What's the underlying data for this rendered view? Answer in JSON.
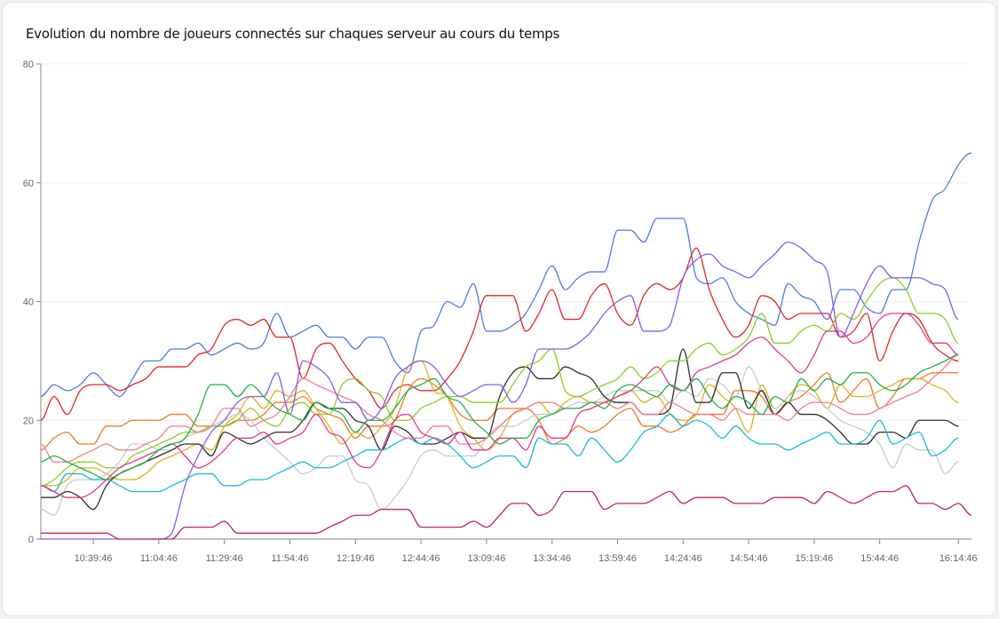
{
  "card": {
    "title": "Evolution du nombre de joueurs connectés sur chaques serveur au cours du temps"
  },
  "chart_data": {
    "type": "line",
    "title": "Evolution du nombre de joueurs connectés sur chaques serveur au cours du temps",
    "xlabel": "",
    "ylabel": "",
    "ylim": [
      0,
      80
    ],
    "yticks": [
      0,
      20,
      40,
      60,
      80
    ],
    "grid": true,
    "legend_position": "bottom",
    "x_start": "10:19:46",
    "x_step_minutes": 5,
    "xtick_labels": [
      "10:39:46",
      "11:04:46",
      "11:29:46",
      "11:54:46",
      "12:19:46",
      "12:44:46",
      "13:09:46",
      "13:34:46",
      "13:59:46",
      "14:24:46",
      "14:54:46",
      "15:19:46",
      "15:44:46",
      "16:14:46"
    ],
    "xtick_index": [
      4,
      9,
      14,
      19,
      24,
      29,
      34,
      39,
      44,
      49,
      54,
      59,
      64,
      70
    ],
    "series": [
      {
        "name": "blue",
        "color": "#4e7fe0",
        "values": [
          24,
          26,
          25,
          26,
          28,
          26,
          24,
          27,
          30,
          30,
          32,
          32,
          33,
          31,
          32,
          33,
          32,
          33,
          38,
          34,
          35,
          36,
          34,
          34,
          32,
          34,
          34,
          30,
          28,
          35,
          36,
          40,
          39,
          43,
          35,
          35,
          36,
          38,
          42,
          46,
          42,
          44,
          45,
          45,
          52,
          52,
          50,
          54,
          54,
          54,
          44,
          43,
          44,
          40,
          38,
          37,
          36,
          43,
          41,
          40,
          37,
          42,
          42,
          39,
          38,
          42,
          42,
          50,
          57,
          59,
          63,
          65
        ]
      },
      {
        "name": "red",
        "color": "#e02828",
        "values": [
          20,
          24,
          21,
          25,
          26,
          26,
          25,
          26,
          27,
          29,
          29,
          29,
          31,
          32,
          36,
          37,
          36,
          37,
          34,
          34,
          27,
          32,
          33,
          30,
          27,
          25,
          22,
          25,
          26,
          25,
          25,
          27,
          30,
          35,
          41,
          41,
          41,
          35,
          38,
          42,
          37,
          37,
          41,
          43,
          38,
          36,
          41,
          43,
          42,
          44,
          49,
          42,
          37,
          34,
          36,
          41,
          40,
          37,
          38,
          38,
          38,
          34,
          35,
          38,
          30,
          35,
          38,
          37,
          33,
          31,
          30
        ]
      },
      {
        "name": "orange",
        "color": "#f07a2a",
        "values": [
          15,
          17,
          18,
          16,
          16,
          19,
          19,
          20,
          20,
          20,
          21,
          21,
          19,
          19,
          19,
          20,
          20,
          21,
          23,
          23,
          24,
          22,
          21,
          20,
          17,
          19,
          19,
          20,
          25,
          27,
          26,
          24,
          21,
          20,
          20,
          22,
          22,
          22,
          20,
          16,
          17,
          19,
          18,
          19,
          21,
          22,
          19,
          19,
          18,
          19,
          21,
          21,
          21,
          25,
          25,
          24,
          21,
          23,
          24,
          26,
          28,
          23,
          25,
          27,
          22,
          24,
          27,
          27,
          28,
          28,
          28
        ]
      },
      {
        "name": "yellow",
        "color": "#dbb51f",
        "values": [
          9,
          9,
          10,
          12,
          12,
          11,
          10,
          10,
          11,
          13,
          14,
          15,
          16,
          15,
          19,
          21,
          24,
          22,
          25,
          24,
          25,
          22,
          19,
          16,
          18,
          17,
          19,
          22,
          29,
          30,
          25,
          24,
          19,
          17,
          15,
          17,
          21,
          22,
          23,
          21,
          23,
          24,
          23,
          23,
          24,
          25,
          23,
          24,
          21,
          20,
          21,
          26,
          24,
          22,
          18,
          26,
          22,
          24,
          26,
          25,
          22,
          26,
          24,
          24,
          25,
          26,
          27,
          27,
          26,
          25,
          23
        ]
      },
      {
        "name": "white",
        "color": "#c8cbd0",
        "values": [
          5,
          4,
          9,
          10,
          10,
          11,
          13,
          16,
          16,
          15,
          15,
          17,
          18,
          19,
          20,
          21,
          20,
          17,
          15,
          13,
          11,
          12,
          14,
          14,
          10,
          9,
          5,
          7,
          10,
          14,
          15,
          14,
          14,
          14,
          17,
          19,
          19,
          20,
          21,
          21,
          22,
          23,
          23,
          24,
          25,
          25,
          25,
          25,
          23,
          25,
          24,
          27,
          26,
          24,
          29,
          25,
          22,
          24,
          25,
          24,
          22,
          20,
          19,
          18,
          16,
          12,
          16,
          15,
          15,
          11,
          13
        ]
      },
      {
        "name": "black",
        "color": "#303030",
        "values": [
          7,
          7,
          8,
          7,
          5,
          9,
          11,
          12,
          13,
          14,
          15,
          16,
          16,
          14,
          18,
          17,
          16,
          17,
          18,
          18,
          20,
          23,
          22,
          22,
          20,
          19,
          15,
          19,
          18,
          16,
          16,
          17,
          18,
          17,
          17,
          24,
          28,
          29,
          27,
          27,
          29,
          28,
          27,
          24,
          23,
          23,
          21,
          21,
          22,
          32,
          23,
          23,
          28,
          28,
          22,
          25,
          21,
          23,
          21,
          21,
          20,
          18,
          16,
          16,
          18,
          18,
          17,
          20,
          20,
          20,
          19
        ]
      },
      {
        "name": "cyan",
        "color": "#1cbcd6",
        "values": [
          9,
          8,
          11,
          11,
          10,
          10,
          9,
          8,
          8,
          8,
          9,
          10,
          11,
          11,
          9,
          9,
          10,
          10,
          11,
          12,
          13,
          12,
          12,
          13,
          14,
          15,
          15,
          16,
          17,
          16,
          17,
          16,
          14,
          12,
          13,
          14,
          14,
          12,
          17,
          16,
          16,
          14,
          17,
          15,
          13,
          15,
          18,
          19,
          21,
          19,
          20,
          19,
          17,
          19,
          17,
          16,
          16,
          15,
          16,
          17,
          18,
          16,
          16,
          17,
          20,
          16,
          17,
          18,
          14,
          15,
          17
        ]
      },
      {
        "name": "lime",
        "color": "#8ccf23",
        "values": [
          9,
          10,
          12,
          13,
          13,
          12,
          12,
          14,
          15,
          16,
          17,
          18,
          18,
          19,
          19,
          20,
          22,
          20,
          19,
          22,
          23,
          21,
          21,
          26,
          27,
          25,
          24,
          20,
          20,
          22,
          23,
          24,
          24,
          23,
          23,
          23,
          26,
          29,
          30,
          32,
          25,
          24,
          25,
          26,
          27,
          29,
          27,
          28,
          30,
          30,
          32,
          33,
          31,
          32,
          34,
          38,
          33,
          33,
          35,
          36,
          35,
          38,
          37,
          40,
          43,
          44,
          42,
          38,
          38,
          37,
          33
        ]
      },
      {
        "name": "coral",
        "color": "#f07f92",
        "values": [
          16,
          13,
          13,
          14,
          15,
          16,
          15,
          15,
          16,
          17,
          19,
          19,
          18,
          19,
          22,
          22,
          19,
          20,
          21,
          24,
          27,
          26,
          25,
          24,
          23,
          21,
          20,
          18,
          17,
          17,
          19,
          19,
          16,
          16,
          17,
          19,
          21,
          22,
          23,
          23,
          22,
          22,
          23,
          23,
          22,
          23,
          21,
          21,
          23,
          22,
          21,
          21,
          20,
          22,
          21,
          21,
          21,
          20,
          22,
          23,
          23,
          22,
          21,
          21,
          22,
          23,
          24,
          25,
          27,
          29,
          31
        ]
      },
      {
        "name": "pink",
        "color": "#e43a8c",
        "values": [
          9,
          8,
          7,
          7,
          8,
          10,
          12,
          13,
          14,
          15,
          16,
          14,
          12,
          13,
          15,
          17,
          17,
          18,
          16,
          17,
          18,
          21,
          18,
          17,
          13,
          12,
          15,
          20,
          21,
          18,
          17,
          16,
          18,
          15,
          15,
          17,
          17,
          15,
          19,
          17,
          17,
          21,
          22,
          23,
          24,
          25,
          27,
          29,
          26,
          25,
          28,
          29,
          30,
          31,
          33,
          34,
          32,
          30,
          28,
          31,
          35,
          35,
          33,
          34,
          37,
          38,
          38,
          36,
          33,
          33,
          31
        ]
      },
      {
        "name": "purple",
        "color": "#8a5ce6",
        "values": [
          0,
          0,
          0,
          0,
          0,
          0,
          0,
          0,
          0,
          0,
          1,
          9,
          14,
          18,
          20,
          23,
          24,
          24,
          28,
          21,
          30,
          29,
          27,
          23,
          23,
          20,
          22,
          27,
          29,
          30,
          29,
          26,
          24,
          25,
          26,
          26,
          23,
          26,
          32,
          32,
          32,
          33,
          35,
          38,
          40,
          41,
          35,
          35,
          36,
          44,
          47,
          48,
          46,
          45,
          44,
          46,
          48,
          50,
          49,
          47,
          45,
          34,
          38,
          43,
          46,
          44,
          44,
          44,
          43,
          42,
          37
        ]
      },
      {
        "name": "green",
        "color": "#22b14c",
        "values": [
          13,
          14,
          13,
          12,
          11,
          10,
          11,
          12,
          13,
          15,
          16,
          17,
          21,
          26,
          26,
          24,
          26,
          24,
          22,
          21,
          20,
          23,
          22,
          21,
          18,
          20,
          20,
          22,
          25,
          26,
          27,
          24,
          23,
          20,
          18,
          16,
          17,
          17,
          20,
          21,
          22,
          22,
          23,
          22,
          25,
          26,
          25,
          24,
          26,
          25,
          27,
          24,
          22,
          24,
          23,
          21,
          24,
          23,
          27,
          25,
          27,
          26,
          28,
          28,
          26,
          25,
          26,
          28,
          29,
          30,
          31
        ]
      },
      {
        "name": "ruby",
        "color": "#c0285d",
        "values": [
          1,
          1,
          1,
          1,
          1,
          1,
          0,
          0,
          0,
          0,
          0,
          2,
          2,
          2,
          3,
          1,
          1,
          1,
          1,
          1,
          1,
          1,
          2,
          3,
          4,
          4,
          5,
          5,
          5,
          2,
          2,
          2,
          2,
          3,
          2,
          4,
          6,
          6,
          4,
          5,
          8,
          8,
          8,
          5,
          6,
          6,
          6,
          7,
          8,
          6,
          7,
          7,
          7,
          6,
          6,
          6,
          7,
          7,
          7,
          6,
          8,
          7,
          6,
          7,
          8,
          8,
          9,
          6,
          6,
          5,
          6,
          4
        ]
      }
    ]
  }
}
